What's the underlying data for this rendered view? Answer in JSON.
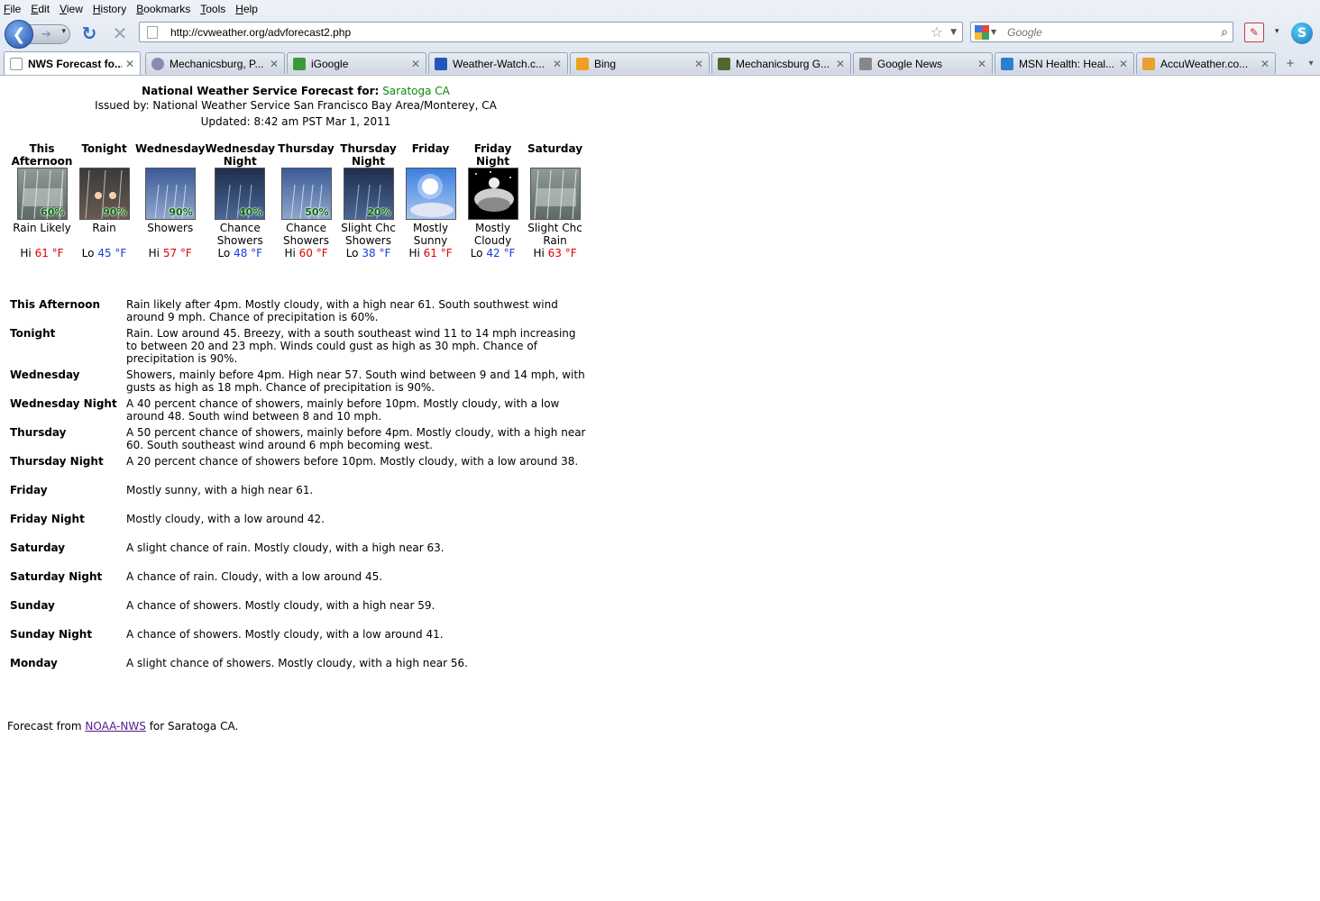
{
  "menu": [
    "File",
    "Edit",
    "View",
    "History",
    "Bookmarks",
    "Tools",
    "Help"
  ],
  "address_bar": {
    "url": "http://cvweather.org/advforecast2.php"
  },
  "search_box": {
    "placeholder": "Google"
  },
  "tabs": [
    {
      "label": "NWS Forecast fo...",
      "active": true,
      "icon_color": "#ffffff"
    },
    {
      "label": "Mechanicsburg, P...",
      "active": false,
      "icon_color": "#8a8ab0"
    },
    {
      "label": "iGoogle",
      "active": false,
      "icon_color": "#3a9a3a"
    },
    {
      "label": "Weather-Watch.c...",
      "active": false,
      "icon_color": "#2255bb"
    },
    {
      "label": "Bing",
      "active": false,
      "icon_color": "#f0a020"
    },
    {
      "label": "Mechanicsburg G...",
      "active": false,
      "icon_color": "#556633"
    },
    {
      "label": "Google News",
      "active": false,
      "icon_color": "#888888"
    },
    {
      "label": "MSN Health: Heal...",
      "active": false,
      "icon_color": "#2a80d0"
    },
    {
      "label": "AccuWeather.co...",
      "active": false,
      "icon_color": "#e8a030"
    }
  ],
  "header": {
    "title_prefix": "National Weather Service Forecast for:",
    "place": "Saratoga CA",
    "issued_by": "Issued by: National Weather Service San Francisco Bay Area/Monterey, CA",
    "updated": "Updated: 8:42 am PST Mar 1, 2011"
  },
  "periods": [
    {
      "name": "This Afternoon",
      "pop": "60%",
      "icon": "rain-icon",
      "cond": "Rain Likely",
      "hilo": "Hi",
      "temp": "61 °F",
      "kind": "hi"
    },
    {
      "name": "Tonight",
      "pop": "90%",
      "icon": "night-rain-icon",
      "cond": "Rain",
      "hilo": "Lo",
      "temp": "45 °F",
      "kind": "lo"
    },
    {
      "name": "Wednesday",
      "pop": "90%",
      "icon": "showers-icon",
      "cond": "Showers",
      "hilo": "Hi",
      "temp": "57 °F",
      "kind": "hi"
    },
    {
      "name": "Wednesday Night",
      "pop": "40%",
      "icon": "night-showers-icon",
      "cond": "Chance Showers",
      "hilo": "Lo",
      "temp": "48 °F",
      "kind": "lo"
    },
    {
      "name": "Thursday",
      "pop": "50%",
      "icon": "showers-icon",
      "cond": "Chance Showers",
      "hilo": "Hi",
      "temp": "60 °F",
      "kind": "hi"
    },
    {
      "name": "Thursday Night",
      "pop": "20%",
      "icon": "night-showers-icon",
      "cond": "Slight Chc Showers",
      "hilo": "Lo",
      "temp": "38 °F",
      "kind": "lo"
    },
    {
      "name": "Friday",
      "pop": "",
      "icon": "mostly-sunny-icon",
      "cond": "Mostly Sunny",
      "hilo": "Hi",
      "temp": "61 °F",
      "kind": "hi"
    },
    {
      "name": "Friday Night",
      "pop": "",
      "icon": "mostly-cloudy-night-icon",
      "cond": "Mostly Cloudy",
      "hilo": "Lo",
      "temp": "42 °F",
      "kind": "lo"
    },
    {
      "name": "Saturday",
      "pop": "",
      "icon": "rain-icon",
      "cond": "Slight Chc Rain",
      "hilo": "Hi",
      "temp": "63 °F",
      "kind": "hi"
    }
  ],
  "details": [
    {
      "name": "This Afternoon",
      "text": "Rain likely after 4pm. Mostly cloudy, with a high near 61. South southwest wind around 9 mph. Chance of precipitation is 60%."
    },
    {
      "name": "Tonight",
      "text": "Rain. Low around 45. Breezy, with a south southeast wind 11 to 14 mph increasing to between 20 and 23 mph. Winds could gust as high as 30 mph. Chance of precipitation is 90%."
    },
    {
      "name": "Wednesday",
      "text": "Showers, mainly before 4pm. High near 57. South wind between 9 and 14 mph, with gusts as high as 18 mph. Chance of precipitation is 90%."
    },
    {
      "name": "Wednesday Night",
      "text": "A 40 percent chance of showers, mainly before 10pm. Mostly cloudy, with a low around 48. South wind between 8 and 10 mph."
    },
    {
      "name": "Thursday",
      "text": "A 50 percent chance of showers, mainly before 4pm. Mostly cloudy, with a high near 60. South southeast wind around 6 mph becoming west."
    },
    {
      "name": "Thursday Night",
      "text": "A 20 percent chance of showers before 10pm. Mostly cloudy, with a low around 38."
    },
    {
      "name": "Friday",
      "text": "Mostly sunny, with a high near 61."
    },
    {
      "name": "Friday Night",
      "text": "Mostly cloudy, with a low around 42."
    },
    {
      "name": "Saturday",
      "text": "A slight chance of rain. Mostly cloudy, with a high near 63."
    },
    {
      "name": "Saturday Night",
      "text": "A chance of rain. Cloudy, with a low around 45."
    },
    {
      "name": "Sunday",
      "text": "A chance of showers. Mostly cloudy, with a high near 59."
    },
    {
      "name": "Sunday Night",
      "text": "A chance of showers. Mostly cloudy, with a low around 41."
    },
    {
      "name": "Monday",
      "text": "A slight chance of showers. Mostly cloudy, with a high near 56."
    }
  ],
  "footer": {
    "prefix": "Forecast from",
    "link": "NOAA-NWS",
    "suffix": "for Saratoga CA."
  },
  "colors": {
    "hi_temp": "#e00000",
    "lo_temp": "#1a3bd6",
    "place": "#0a8a0a",
    "pop": "#0b6b0b"
  }
}
